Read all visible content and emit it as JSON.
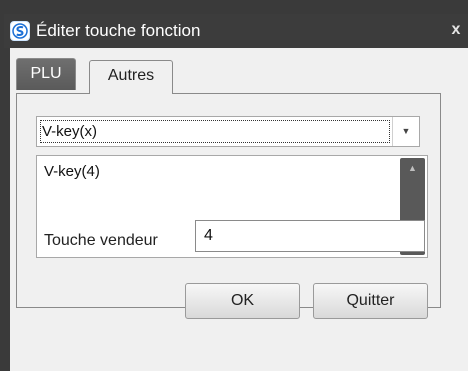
{
  "window": {
    "title": "Éditer touche fonction",
    "close_glyph": "x",
    "icon": "app-logo-icon"
  },
  "tabs": [
    {
      "label": "PLU",
      "active": false
    },
    {
      "label": "Autres",
      "active": true
    }
  ],
  "combo": {
    "value": "V-key(x)",
    "arrow_glyph": "▼"
  },
  "textarea": {
    "value": "V-key(4)"
  },
  "touche_vendeur": {
    "label": "Touche vendeur",
    "value": "4"
  },
  "buttons": {
    "ok": "OK",
    "quit": "Quitter"
  },
  "colors": {
    "titlebar": "#3c3c3c",
    "frame": "#3a3a3a",
    "client": "#f0f0f0",
    "tab_inactive": "#6f6f6f",
    "scrollbar": "#595959"
  }
}
